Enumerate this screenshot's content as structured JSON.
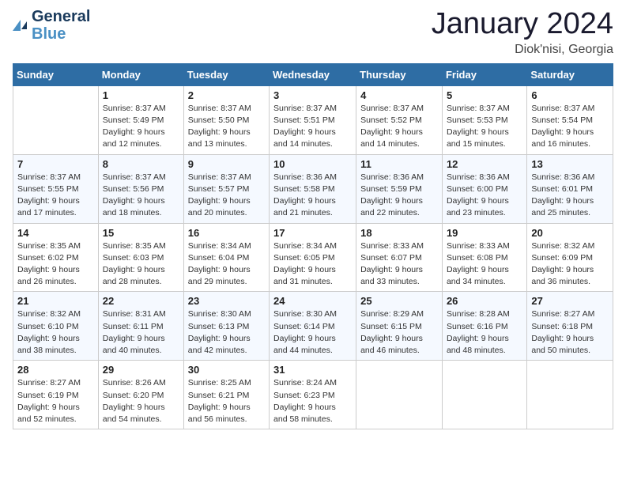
{
  "header": {
    "logo_line1": "General",
    "logo_line2": "Blue",
    "month": "January 2024",
    "location": "Diok'nisi, Georgia"
  },
  "days_of_week": [
    "Sunday",
    "Monday",
    "Tuesday",
    "Wednesday",
    "Thursday",
    "Friday",
    "Saturday"
  ],
  "weeks": [
    [
      {
        "day": "",
        "sunrise": "",
        "sunset": "",
        "daylight": ""
      },
      {
        "day": "1",
        "sunrise": "Sunrise: 8:37 AM",
        "sunset": "Sunset: 5:49 PM",
        "daylight": "Daylight: 9 hours and 12 minutes."
      },
      {
        "day": "2",
        "sunrise": "Sunrise: 8:37 AM",
        "sunset": "Sunset: 5:50 PM",
        "daylight": "Daylight: 9 hours and 13 minutes."
      },
      {
        "day": "3",
        "sunrise": "Sunrise: 8:37 AM",
        "sunset": "Sunset: 5:51 PM",
        "daylight": "Daylight: 9 hours and 14 minutes."
      },
      {
        "day": "4",
        "sunrise": "Sunrise: 8:37 AM",
        "sunset": "Sunset: 5:52 PM",
        "daylight": "Daylight: 9 hours and 14 minutes."
      },
      {
        "day": "5",
        "sunrise": "Sunrise: 8:37 AM",
        "sunset": "Sunset: 5:53 PM",
        "daylight": "Daylight: 9 hours and 15 minutes."
      },
      {
        "day": "6",
        "sunrise": "Sunrise: 8:37 AM",
        "sunset": "Sunset: 5:54 PM",
        "daylight": "Daylight: 9 hours and 16 minutes."
      }
    ],
    [
      {
        "day": "7",
        "sunrise": "Sunrise: 8:37 AM",
        "sunset": "Sunset: 5:55 PM",
        "daylight": "Daylight: 9 hours and 17 minutes."
      },
      {
        "day": "8",
        "sunrise": "Sunrise: 8:37 AM",
        "sunset": "Sunset: 5:56 PM",
        "daylight": "Daylight: 9 hours and 18 minutes."
      },
      {
        "day": "9",
        "sunrise": "Sunrise: 8:37 AM",
        "sunset": "Sunset: 5:57 PM",
        "daylight": "Daylight: 9 hours and 20 minutes."
      },
      {
        "day": "10",
        "sunrise": "Sunrise: 8:36 AM",
        "sunset": "Sunset: 5:58 PM",
        "daylight": "Daylight: 9 hours and 21 minutes."
      },
      {
        "day": "11",
        "sunrise": "Sunrise: 8:36 AM",
        "sunset": "Sunset: 5:59 PM",
        "daylight": "Daylight: 9 hours and 22 minutes."
      },
      {
        "day": "12",
        "sunrise": "Sunrise: 8:36 AM",
        "sunset": "Sunset: 6:00 PM",
        "daylight": "Daylight: 9 hours and 23 minutes."
      },
      {
        "day": "13",
        "sunrise": "Sunrise: 8:36 AM",
        "sunset": "Sunset: 6:01 PM",
        "daylight": "Daylight: 9 hours and 25 minutes."
      }
    ],
    [
      {
        "day": "14",
        "sunrise": "Sunrise: 8:35 AM",
        "sunset": "Sunset: 6:02 PM",
        "daylight": "Daylight: 9 hours and 26 minutes."
      },
      {
        "day": "15",
        "sunrise": "Sunrise: 8:35 AM",
        "sunset": "Sunset: 6:03 PM",
        "daylight": "Daylight: 9 hours and 28 minutes."
      },
      {
        "day": "16",
        "sunrise": "Sunrise: 8:34 AM",
        "sunset": "Sunset: 6:04 PM",
        "daylight": "Daylight: 9 hours and 29 minutes."
      },
      {
        "day": "17",
        "sunrise": "Sunrise: 8:34 AM",
        "sunset": "Sunset: 6:05 PM",
        "daylight": "Daylight: 9 hours and 31 minutes."
      },
      {
        "day": "18",
        "sunrise": "Sunrise: 8:33 AM",
        "sunset": "Sunset: 6:07 PM",
        "daylight": "Daylight: 9 hours and 33 minutes."
      },
      {
        "day": "19",
        "sunrise": "Sunrise: 8:33 AM",
        "sunset": "Sunset: 6:08 PM",
        "daylight": "Daylight: 9 hours and 34 minutes."
      },
      {
        "day": "20",
        "sunrise": "Sunrise: 8:32 AM",
        "sunset": "Sunset: 6:09 PM",
        "daylight": "Daylight: 9 hours and 36 minutes."
      }
    ],
    [
      {
        "day": "21",
        "sunrise": "Sunrise: 8:32 AM",
        "sunset": "Sunset: 6:10 PM",
        "daylight": "Daylight: 9 hours and 38 minutes."
      },
      {
        "day": "22",
        "sunrise": "Sunrise: 8:31 AM",
        "sunset": "Sunset: 6:11 PM",
        "daylight": "Daylight: 9 hours and 40 minutes."
      },
      {
        "day": "23",
        "sunrise": "Sunrise: 8:30 AM",
        "sunset": "Sunset: 6:13 PM",
        "daylight": "Daylight: 9 hours and 42 minutes."
      },
      {
        "day": "24",
        "sunrise": "Sunrise: 8:30 AM",
        "sunset": "Sunset: 6:14 PM",
        "daylight": "Daylight: 9 hours and 44 minutes."
      },
      {
        "day": "25",
        "sunrise": "Sunrise: 8:29 AM",
        "sunset": "Sunset: 6:15 PM",
        "daylight": "Daylight: 9 hours and 46 minutes."
      },
      {
        "day": "26",
        "sunrise": "Sunrise: 8:28 AM",
        "sunset": "Sunset: 6:16 PM",
        "daylight": "Daylight: 9 hours and 48 minutes."
      },
      {
        "day": "27",
        "sunrise": "Sunrise: 8:27 AM",
        "sunset": "Sunset: 6:18 PM",
        "daylight": "Daylight: 9 hours and 50 minutes."
      }
    ],
    [
      {
        "day": "28",
        "sunrise": "Sunrise: 8:27 AM",
        "sunset": "Sunset: 6:19 PM",
        "daylight": "Daylight: 9 hours and 52 minutes."
      },
      {
        "day": "29",
        "sunrise": "Sunrise: 8:26 AM",
        "sunset": "Sunset: 6:20 PM",
        "daylight": "Daylight: 9 hours and 54 minutes."
      },
      {
        "day": "30",
        "sunrise": "Sunrise: 8:25 AM",
        "sunset": "Sunset: 6:21 PM",
        "daylight": "Daylight: 9 hours and 56 minutes."
      },
      {
        "day": "31",
        "sunrise": "Sunrise: 8:24 AM",
        "sunset": "Sunset: 6:23 PM",
        "daylight": "Daylight: 9 hours and 58 minutes."
      },
      {
        "day": "",
        "sunrise": "",
        "sunset": "",
        "daylight": ""
      },
      {
        "day": "",
        "sunrise": "",
        "sunset": "",
        "daylight": ""
      },
      {
        "day": "",
        "sunrise": "",
        "sunset": "",
        "daylight": ""
      }
    ]
  ]
}
